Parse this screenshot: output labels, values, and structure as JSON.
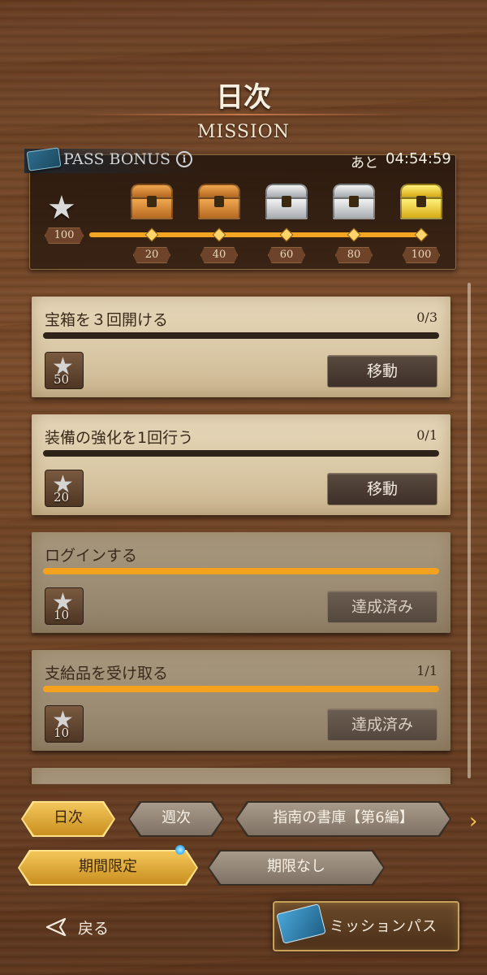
{
  "header": {
    "title": "日次",
    "subtitle": "MISSION"
  },
  "pass_bonus": {
    "label": "PASS BONUS",
    "info_glyph": "i",
    "timer_prefix": "あと",
    "timer_value": "04:54:59",
    "current_stars": "100",
    "progress_fraction": 1.0,
    "milestones": [
      {
        "value": "20",
        "chest": "bronze"
      },
      {
        "value": "40",
        "chest": "bronze"
      },
      {
        "value": "60",
        "chest": "silver"
      },
      {
        "value": "80",
        "chest": "silver"
      },
      {
        "value": "100",
        "chest": "gold"
      }
    ]
  },
  "missions": [
    {
      "title": "宝箱を３回開ける",
      "progress": "0/3",
      "fill": 0,
      "reward": "50",
      "button": "移動",
      "done": false
    },
    {
      "title": "装備の強化を1回行う",
      "progress": "0/1",
      "fill": 0,
      "reward": "20",
      "button": "移動",
      "done": false
    },
    {
      "title": "ログインする",
      "progress": "",
      "fill": 1,
      "reward": "10",
      "button": "達成済み",
      "done": true
    },
    {
      "title": "支給品を受け取る",
      "progress": "1/1",
      "fill": 1,
      "reward": "10",
      "button": "達成済み",
      "done": true
    }
  ],
  "tabs": {
    "row1": [
      {
        "label": "日次",
        "active": true
      },
      {
        "label": "週次",
        "active": false
      },
      {
        "label": "指南の書庫【第6編】",
        "active": false
      }
    ],
    "row2": [
      {
        "label": "期間限定",
        "active": true
      },
      {
        "label": "期限なし",
        "active": false
      }
    ],
    "more_glyph": "›"
  },
  "footer": {
    "back_label": "戻る",
    "mission_pass_label": "ミッションパス"
  },
  "colors": {
    "accent_orange": "#f4a623",
    "tab_active": "#f3c65a",
    "new_dot": "#3fb4ff"
  }
}
